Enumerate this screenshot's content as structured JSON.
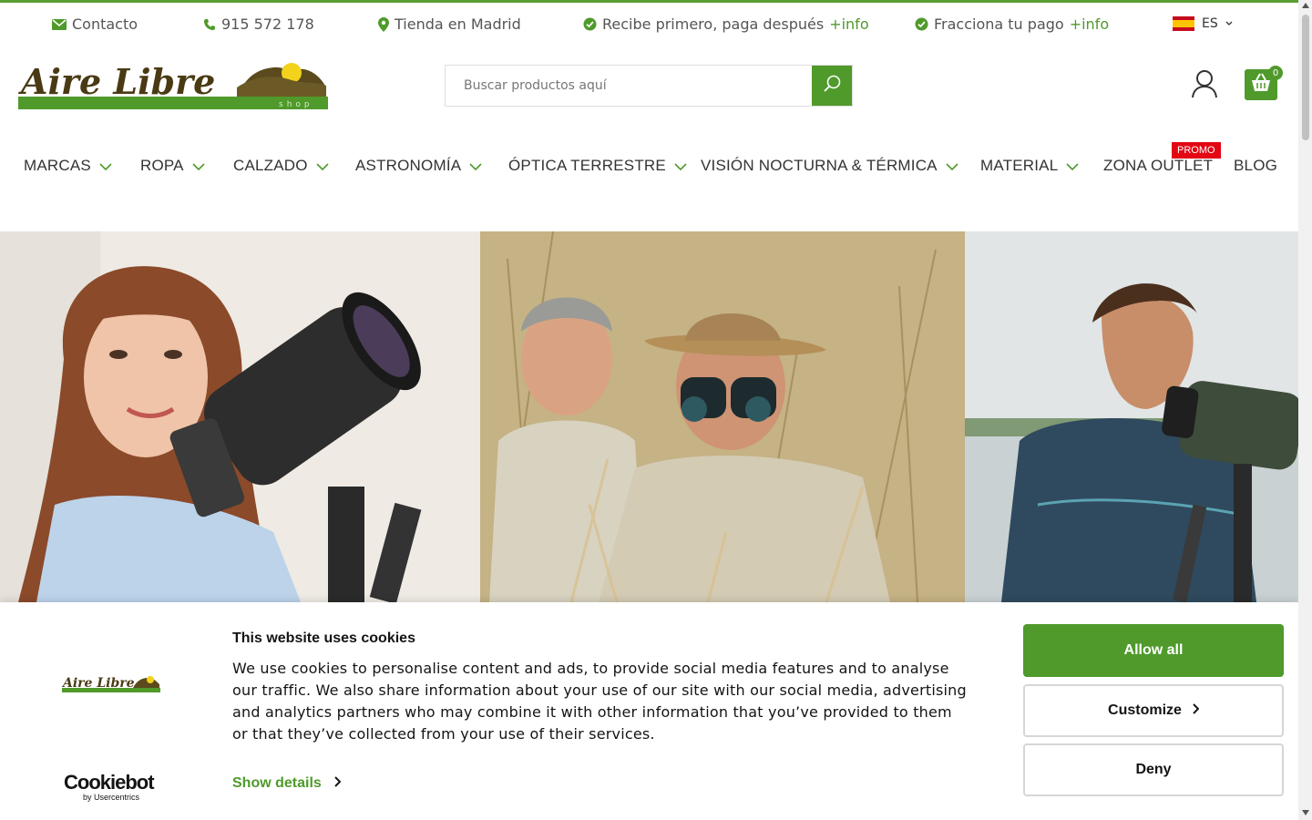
{
  "topbar": {
    "contact": "Contacto",
    "phone": "915 572 178",
    "store": "Tienda en Madrid",
    "pay_later": "Recibe primero, paga después",
    "pay_later_link": "+info",
    "split_pay": "Fracciona tu pago",
    "split_pay_link": "+info",
    "language": "ES"
  },
  "brand": {
    "logo_text": "Aire Libre",
    "logo_sub": "shop",
    "colors": {
      "primary": "#4f9a2b",
      "accent": "#e30613"
    }
  },
  "search": {
    "placeholder": "Buscar productos aquí"
  },
  "cart": {
    "count": "0"
  },
  "nav": {
    "items": [
      {
        "label": "MARCAS",
        "dropdown": true
      },
      {
        "label": "ROPA",
        "dropdown": true
      },
      {
        "label": "CALZADO",
        "dropdown": true
      },
      {
        "label": "ASTRONOMÍA",
        "dropdown": true
      },
      {
        "label": "ÓPTICA TERRESTRE",
        "dropdown": true
      },
      {
        "label": "VISIÓN NOCTURNA & TÉRMICA",
        "dropdown": true
      },
      {
        "label": "MATERIAL",
        "dropdown": true
      },
      {
        "label": "ZONA OUTLET",
        "dropdown": false
      },
      {
        "label": "BLOG",
        "dropdown": false
      }
    ],
    "promo_badge": "PROMO"
  },
  "hero": {
    "panels": [
      "woman-with-telescope",
      "men-with-binoculars",
      "man-with-spotting-scope"
    ]
  },
  "cookie": {
    "title": "This website uses cookies",
    "body": "We use cookies to personalise content and ads, to provide social media features and to analyse our traffic. We also share information about your use of our site with our social media, advertising and analytics partners who may combine it with other information that you’ve provided to them or that they’ve collected from your use of their services.",
    "show_details": "Show details",
    "allow_all": "Allow all",
    "customize": "Customize",
    "deny": "Deny",
    "cookiebot_brand": "Cookiebot",
    "cookiebot_by": "by Usercentrics"
  }
}
